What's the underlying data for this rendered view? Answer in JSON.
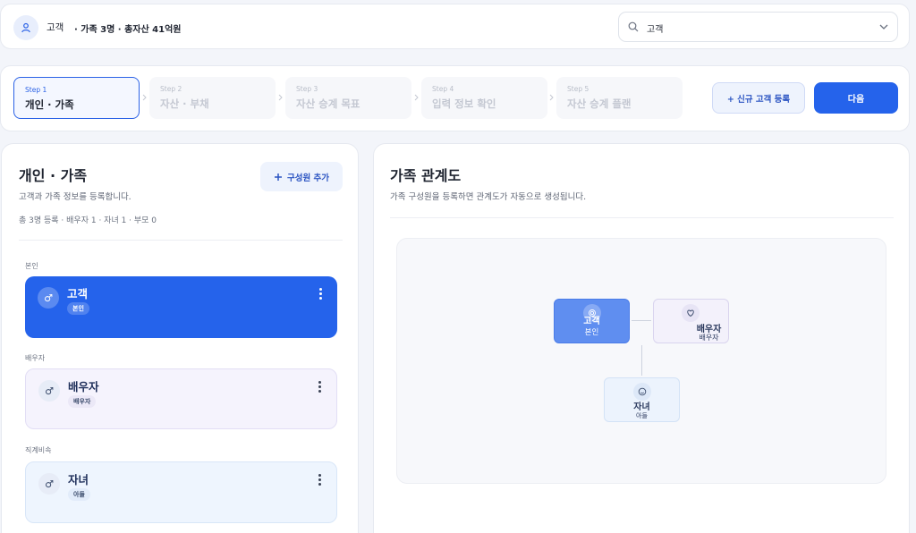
{
  "header": {
    "customer_name": "고객",
    "summary": "· 가족 3명 · 총자산 41억원",
    "search_value": "고객"
  },
  "steps": [
    {
      "num": "Step 1",
      "label": "개인 · 가족",
      "active": true
    },
    {
      "num": "Step 2",
      "label": "자산 · 부채",
      "active": false
    },
    {
      "num": "Step 3",
      "label": "자산 승계 목표",
      "active": false
    },
    {
      "num": "Step 4",
      "label": "입력 정보 확인",
      "active": false
    },
    {
      "num": "Step 5",
      "label": "자산 승계 플랜",
      "active": false
    }
  ],
  "actions": {
    "new_customer": "+ 신규 고객 등록",
    "next": "다음"
  },
  "left_panel": {
    "title": "개인 · 가족",
    "description": "고객과 가족 정보를 등록합니다.",
    "count": "총 3명 등록 · 배우자 1 · 자녀 1 · 부모 0",
    "add_button": "구성원 추가",
    "sections": {
      "self": "본인",
      "spouse": "배우자",
      "lineal": "직계비속"
    },
    "members": [
      {
        "name": "고객",
        "tag": "본인"
      },
      {
        "name": "배우자",
        "tag": "배우자"
      },
      {
        "name": "자녀",
        "tag": "아들"
      }
    ]
  },
  "right_panel": {
    "title": "가족 관계도",
    "description": "가족 구성원을 등록하면 관계도가 자동으로 생성됩니다.",
    "nodes": [
      {
        "name": "고객",
        "role": "본인"
      },
      {
        "name": "배우자",
        "role": "배우자"
      },
      {
        "name": "자녀",
        "role": "아들"
      }
    ]
  },
  "colors": {
    "primary": "#2563eb",
    "self_node": "#5f8ef0",
    "spouse_bg": "#f5f3fd",
    "child_bg": "#eef5fe"
  },
  "icons": {
    "avatar": "user-icon",
    "search": "search-icon",
    "dropdown": "chevron-down-icon",
    "gender": "male-icon",
    "more": "more-vertical-icon",
    "spouse_node": "heart-icon",
    "child_node": "smile-icon"
  }
}
